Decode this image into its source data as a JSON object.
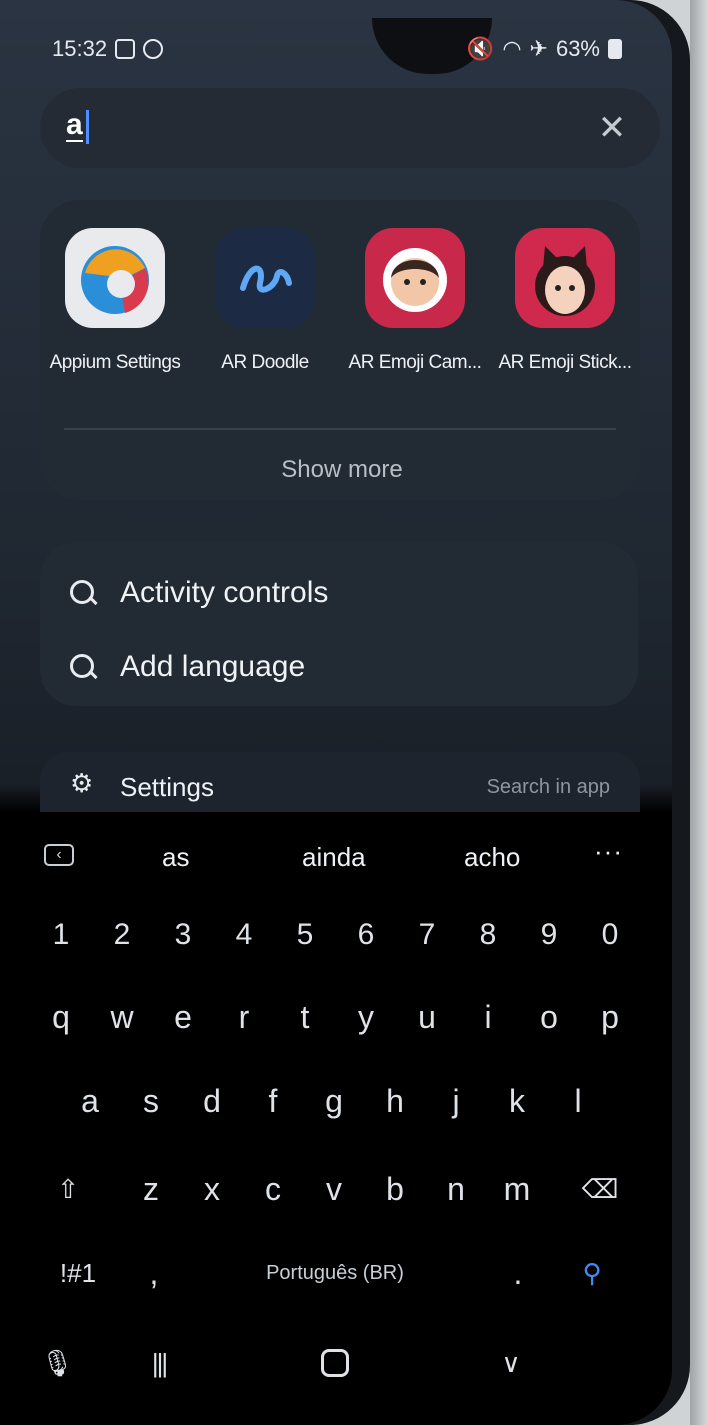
{
  "status_bar": {
    "time": "15:32",
    "battery": "63%",
    "icons": [
      "gallery-icon",
      "sync-icon",
      "mute-icon",
      "wifi-icon",
      "airplane-icon",
      "battery-icon"
    ]
  },
  "search": {
    "query": "a",
    "clear_icon": "close-icon"
  },
  "apps": [
    {
      "label": "Appium Settings",
      "icon": "appium-settings-icon"
    },
    {
      "label": "AR Doodle",
      "icon": "ar-doodle-icon"
    },
    {
      "label": "AR Emoji Cam...",
      "icon": "ar-emoji-camera-icon"
    },
    {
      "label": "AR Emoji Stick...",
      "icon": "ar-emoji-stickers-icon"
    }
  ],
  "show_more": "Show more",
  "results": [
    {
      "text": "Activity controls"
    },
    {
      "text": "Add language"
    }
  ],
  "settings_result": {
    "label": "Settings",
    "action": "Search in app"
  },
  "suggestions": {
    "words": [
      "as",
      "ainda",
      "acho"
    ],
    "more": "···"
  },
  "keyboard": {
    "numbers": [
      "1",
      "2",
      "3",
      "4",
      "5",
      "6",
      "7",
      "8",
      "9",
      "0"
    ],
    "row1": [
      "q",
      "w",
      "e",
      "r",
      "t",
      "y",
      "u",
      "i",
      "o",
      "p"
    ],
    "row2": [
      "a",
      "s",
      "d",
      "f",
      "g",
      "h",
      "j",
      "k",
      "l"
    ],
    "row3": [
      "z",
      "x",
      "c",
      "v",
      "b",
      "n",
      "m"
    ],
    "shift": "⇧",
    "backspace": "⌫",
    "symbols": "!#1",
    "comma": ",",
    "space": "Português (BR)",
    "period": ".",
    "search": "⚲"
  },
  "navbar": {
    "mic": "🎙",
    "recents": "|||",
    "back": "∨"
  }
}
